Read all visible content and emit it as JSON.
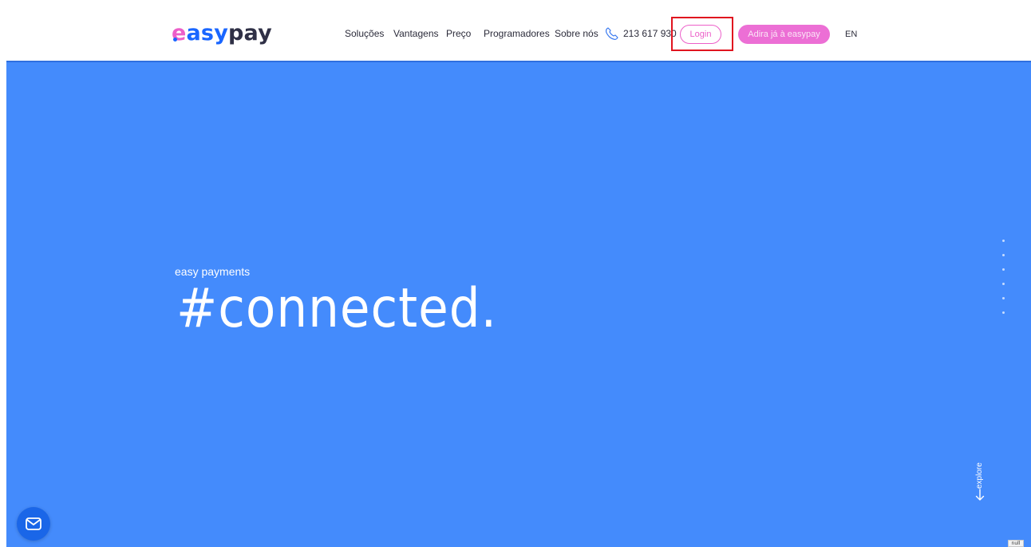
{
  "brand": {
    "logo_e": "e",
    "logo_asy": "asy",
    "logo_pay": "pay"
  },
  "nav": {
    "items": [
      {
        "label": "Soluções"
      },
      {
        "label": "Vantagens"
      },
      {
        "label": "Preço"
      },
      {
        "label": "Programadores"
      },
      {
        "label": "Sobre nós"
      }
    ],
    "phone": "213 617 930",
    "login_label": "Login",
    "join_label": "Adira já à easypay",
    "lang_label": "EN"
  },
  "hero": {
    "kicker": "easy payments",
    "title": "#connected.",
    "explore_label": "explore"
  },
  "badge": {
    "label": "null"
  },
  "colors": {
    "hero_bg": "#448bfc",
    "accent_pink": "#ec5fc9",
    "brand_blue": "#1a66ff",
    "highlight_red": "#e0141f"
  }
}
